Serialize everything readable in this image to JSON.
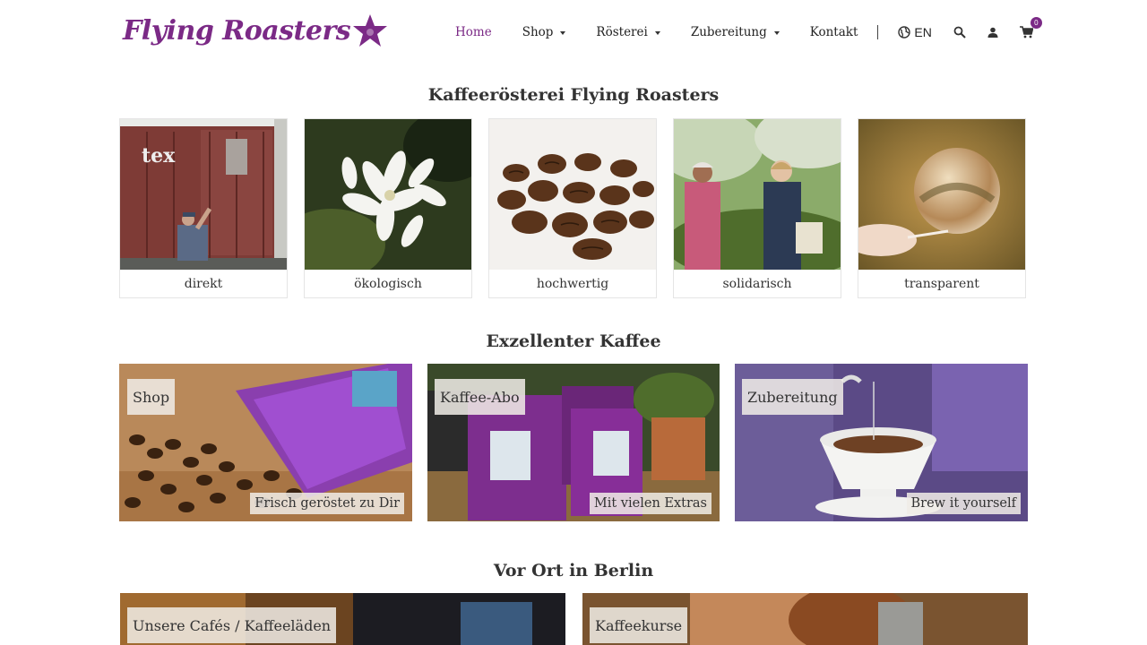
{
  "header": {
    "logo": "Flying Roasters",
    "nav": [
      {
        "label": "Home",
        "active": true,
        "dropdown": false
      },
      {
        "label": "Shop",
        "active": false,
        "dropdown": true
      },
      {
        "label": "Rösterei",
        "active": false,
        "dropdown": true
      },
      {
        "label": "Zubereitung",
        "active": false,
        "dropdown": true
      },
      {
        "label": "Kontakt",
        "active": false,
        "dropdown": false
      }
    ],
    "language": "EN",
    "cart_count": "0",
    "accent_color": "#7b2a86"
  },
  "sections": {
    "intro_title": "Kaffeerösterei Flying Roasters",
    "coffee_title": "Exzellenter Kaffee",
    "berlin_title": "Vor Ort in Berlin"
  },
  "values": [
    {
      "label": "direkt"
    },
    {
      "label": "ökologisch"
    },
    {
      "label": "hochwertig"
    },
    {
      "label": "solidarisch"
    },
    {
      "label": "transparent"
    }
  ],
  "coffee_tiles": [
    {
      "title": "Shop",
      "subtitle": "Frisch geröstet zu Dir"
    },
    {
      "title": "Kaffee-Abo",
      "subtitle": "Mit vielen Extras"
    },
    {
      "title": "Zubereitung",
      "subtitle": "Brew it yourself"
    }
  ],
  "berlin_tiles": [
    {
      "title": "Unsere Cafés / Kaffeeläden"
    },
    {
      "title": "Kaffeekurse"
    }
  ]
}
